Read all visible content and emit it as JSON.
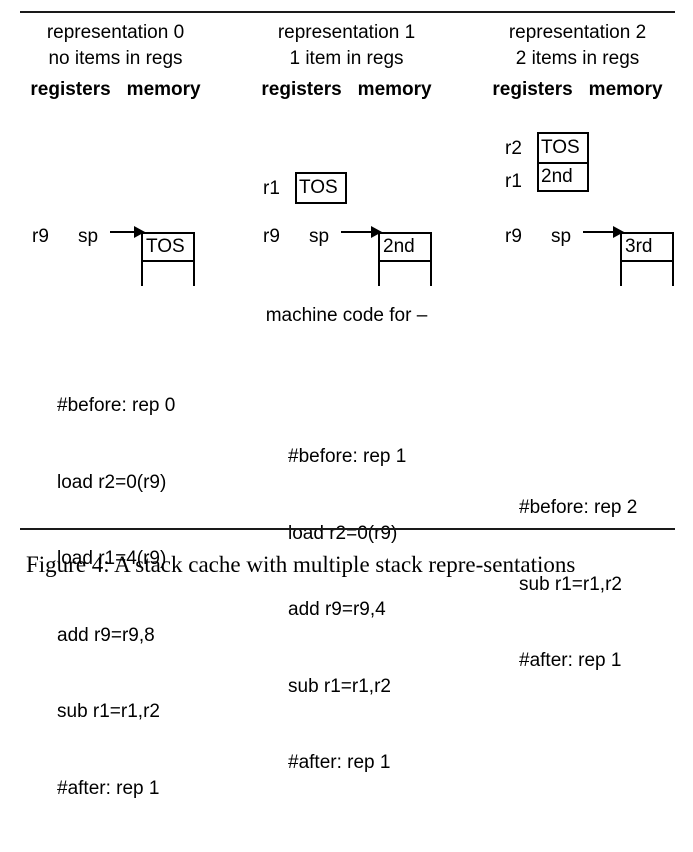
{
  "figure": {
    "caption": "Figure 4: A stack cache with multiple stack repre-sentations",
    "machine_code_label": "machine code for –"
  },
  "columns": [
    {
      "title_line1": "representation 0",
      "title_line2": "no items in regs",
      "header_registers": "registers",
      "header_memory": "memory",
      "registers": {
        "labels": [],
        "cells": []
      },
      "sp_register": "r9",
      "sp_name": "sp",
      "memory_top_cell": "TOS",
      "code": [
        "#before: rep 0",
        "load r2=0(r9)",
        "load r1=4(r9)",
        "add r9=r9,8",
        "sub r1=r1,r2",
        "#after: rep 1"
      ]
    },
    {
      "title_line1": "representation 1",
      "title_line2": "1 item in regs",
      "header_registers": "registers",
      "header_memory": "memory",
      "registers": {
        "labels": [
          "r1"
        ],
        "cells": [
          "TOS"
        ]
      },
      "sp_register": "r9",
      "sp_name": "sp",
      "memory_top_cell": "2nd",
      "code": [
        "#before: rep 1",
        "load r2=0(r9)",
        "add r9=r9,4",
        "sub r1=r1,r2",
        "#after: rep 1"
      ]
    },
    {
      "title_line1": "representation 2",
      "title_line2": "2 items in regs",
      "header_registers": "registers",
      "header_memory": "memory",
      "registers": {
        "labels": [
          "r2",
          "r1"
        ],
        "cells": [
          "TOS",
          "2nd"
        ]
      },
      "sp_register": "r9",
      "sp_name": "sp",
      "memory_top_cell": "3rd",
      "code": [
        "#before: rep 2",
        "sub r1=r1,r2",
        "#after: rep 1"
      ]
    }
  ],
  "style": {
    "ink": "#000000",
    "background": "#ffffff"
  }
}
